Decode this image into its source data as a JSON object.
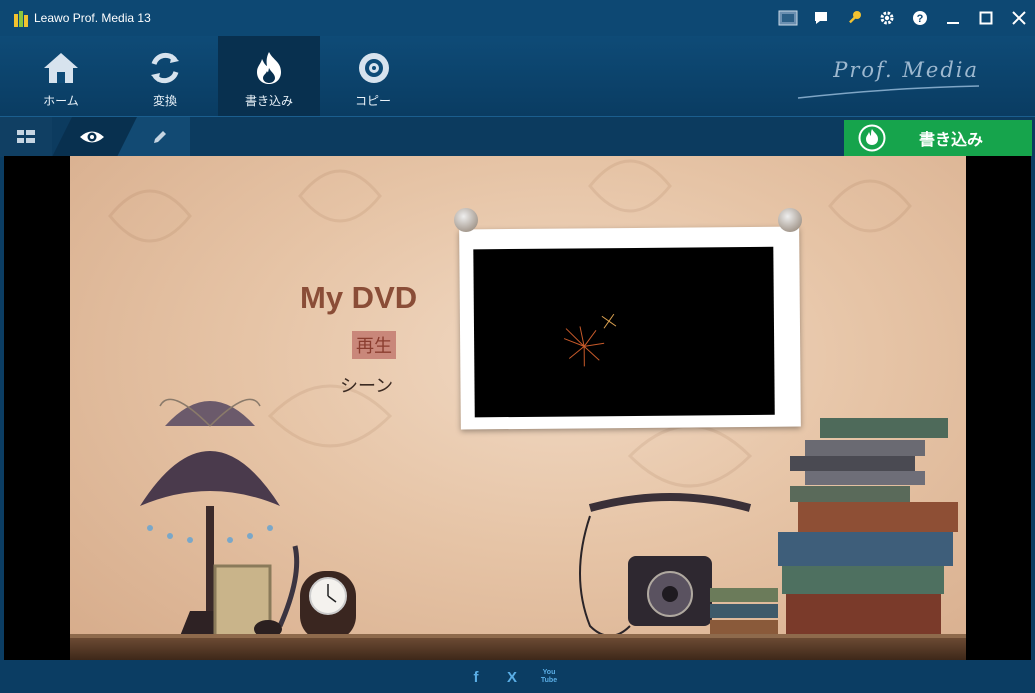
{
  "window": {
    "title": "Leawo Prof. Media 13"
  },
  "titlebar_icons": [
    {
      "name": "screenshot-icon"
    },
    {
      "name": "chat-icon"
    },
    {
      "name": "key-icon"
    },
    {
      "name": "gear-icon"
    },
    {
      "name": "help-icon"
    },
    {
      "name": "minimize-icon"
    },
    {
      "name": "maximize-icon"
    },
    {
      "name": "close-icon"
    }
  ],
  "nav": {
    "tabs": [
      {
        "label": "ホーム",
        "icon": "home-icon"
      },
      {
        "label": "変換",
        "icon": "convert-icon"
      },
      {
        "label": "書き込み",
        "icon": "burn-icon",
        "active": true
      },
      {
        "label": "コピー",
        "icon": "copy-disc-icon"
      }
    ],
    "brand": "Prof. Media"
  },
  "toolbar": {
    "burn_button_label": "書き込み",
    "burn_button_color": "#16a44c"
  },
  "preview": {
    "menu_title": "My DVD",
    "play_label": "再生",
    "scene_label": "シーン"
  },
  "footer": {
    "social": [
      {
        "label": "f",
        "icon": "facebook-icon"
      },
      {
        "label": "X",
        "icon": "x-icon"
      },
      {
        "label": "You Tube",
        "icon": "youtube-icon"
      }
    ]
  },
  "colors": {
    "accent": "#0d4873",
    "burn_green": "#16a44c"
  }
}
